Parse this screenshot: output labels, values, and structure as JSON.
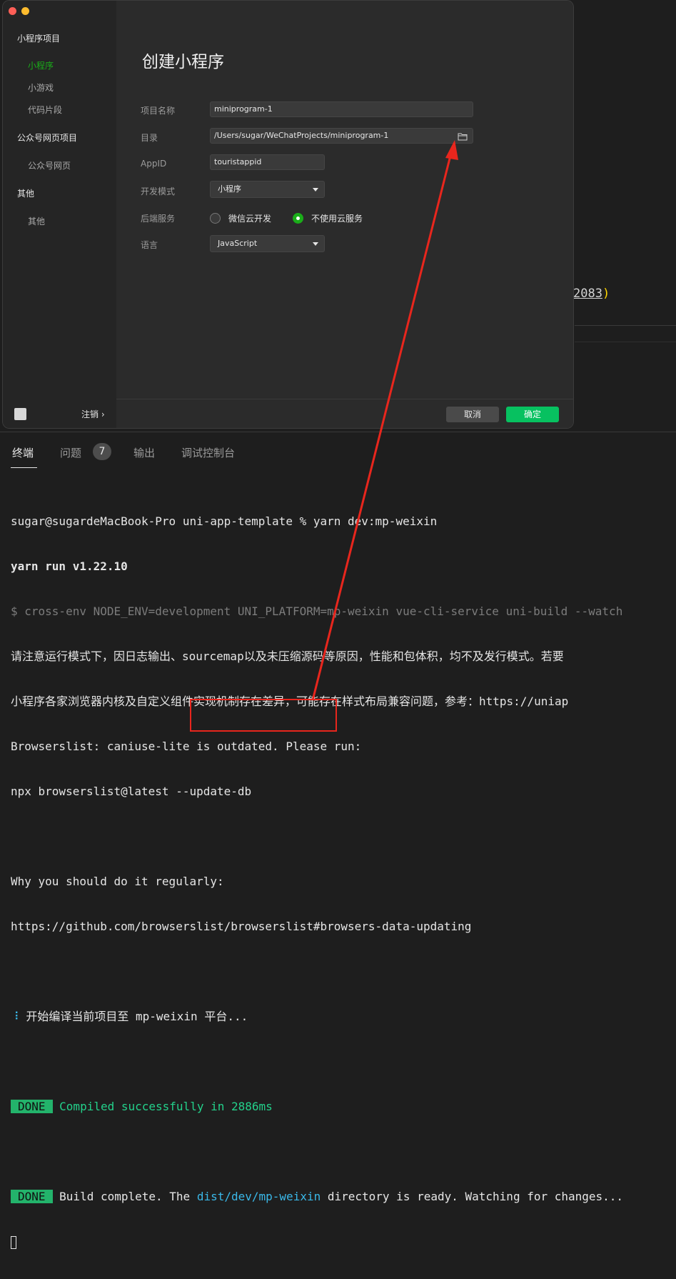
{
  "background_editor": {
    "snippet_number": "2083",
    "snippet_paren": ")"
  },
  "dialog": {
    "sidebar": {
      "groups": [
        {
          "label": "小程序项目",
          "items": [
            {
              "label": "小程序",
              "active": true
            },
            {
              "label": "小游戏",
              "active": false
            },
            {
              "label": "代码片段",
              "active": false
            }
          ]
        },
        {
          "label": "公众号网页项目",
          "items": [
            {
              "label": "公众号网页",
              "active": false
            }
          ]
        },
        {
          "label": "其他",
          "items": [
            {
              "label": "其他",
              "active": false
            }
          ]
        }
      ],
      "logout_label": "注销 ›"
    },
    "title": "创建小程序",
    "form": {
      "name_label": "项目名称",
      "name_value": "miniprogram-1",
      "dir_label": "目录",
      "dir_value": "/Users/sugar/WeChatProjects/miniprogram-1",
      "appid_label": "AppID",
      "appid_value": "touristappid",
      "mode_label": "开发模式",
      "mode_value": "小程序",
      "backend_label": "后端服务",
      "backend_option_cloud": "微信云开发",
      "backend_option_none": "不使用云服务",
      "backend_selected": "不使用云服务",
      "lang_label": "语言",
      "lang_value": "JavaScript"
    },
    "buttons": {
      "cancel": "取消",
      "confirm": "确定"
    }
  },
  "panel": {
    "tabs": [
      {
        "label": "终端",
        "active": true
      },
      {
        "label": "问题",
        "active": false,
        "badge": "7"
      },
      {
        "label": "输出",
        "active": false
      },
      {
        "label": "调试控制台",
        "active": false
      }
    ],
    "terminal_lines": {
      "l1": "sugar@sugardeMacBook-Pro uni-app-template % yarn dev:mp-weixin",
      "l2": "yarn run v1.22.10",
      "l3": "$ cross-env NODE_ENV=development UNI_PLATFORM=mp-weixin vue-cli-service uni-build --watch",
      "l4": "请注意运行模式下，因日志输出、sourcemap以及未压缩源码等原因，性能和包体积，均不及发行模式。若要",
      "l5": "小程序各家浏览器内核及自定义组件实现机制存在差异，可能存在样式布局兼容问题，参考：https://uniap",
      "l6": "Browserslist: caniuse-lite is outdated. Please run:",
      "l7": "npx browserslist@latest --update-db",
      "l9": "Why you should do it regularly:",
      "l10": "https://github.com/browserslist/browserslist#browsers-data-updating",
      "l12_icon": "⠸",
      "l12": " 开始编译当前项目至 mp-weixin 平台...",
      "done_tag": "DONE",
      "l14": " Compiled successfully in 2886ms",
      "l16_a": " Build complete. The ",
      "l16_path": "dist/dev/mp-weixin",
      "l16_b": " directory is ready. Watching for changes..."
    }
  },
  "colors": {
    "accent_green": "#07c160",
    "sidebar_active": "#1aad19",
    "annotation_red": "#e8261d",
    "terminal_cyan": "#3ab8e8",
    "terminal_green": "#23d18b"
  }
}
